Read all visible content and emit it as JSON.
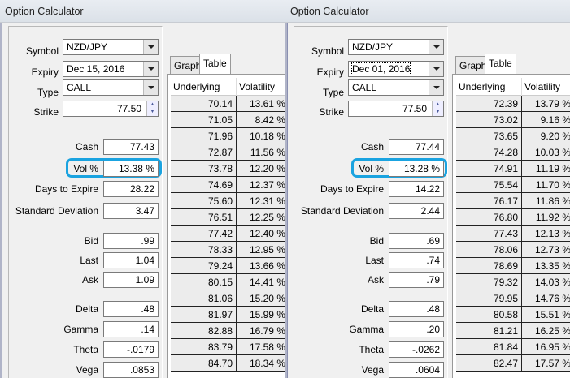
{
  "labels": {
    "symbol": "Symbol",
    "expiry": "Expiry",
    "type": "Type",
    "strike": "Strike",
    "cash": "Cash",
    "vol": "Vol %",
    "days": "Days to Expire",
    "sd": "Standard Deviation",
    "bid": "Bid",
    "last": "Last",
    "ask": "Ask",
    "delta": "Delta",
    "gamma": "Gamma",
    "theta": "Theta",
    "vega": "Vega",
    "tab_graph": "Graph",
    "tab_table": "Table",
    "col_underlying": "Underlying",
    "col_volatility": "Volatility"
  },
  "accent": "#1aa3e0",
  "panels": [
    {
      "title": "Option Calculator",
      "symbol": "NZD/JPY",
      "expiry": "Dec 15, 2016",
      "type": "CALL",
      "strike": "77.50",
      "cash": "77.43",
      "vol": "13.38 %",
      "days": "28.22",
      "sd": "3.47",
      "bid": ".99",
      "last": "1.04",
      "ask": "1.09",
      "delta": ".48",
      "gamma": ".14",
      "theta": "-.0179",
      "vega": ".0853",
      "rows": [
        [
          "70.14",
          "13.61 %"
        ],
        [
          "71.05",
          "8.42 %"
        ],
        [
          "71.96",
          "10.18 %"
        ],
        [
          "72.87",
          "11.56 %"
        ],
        [
          "73.78",
          "12.20 %"
        ],
        [
          "74.69",
          "12.37 %"
        ],
        [
          "75.60",
          "12.31 %"
        ],
        [
          "76.51",
          "12.25 %"
        ],
        [
          "77.42",
          "12.40 %"
        ],
        [
          "78.33",
          "12.95 %"
        ],
        [
          "79.24",
          "13.66 %"
        ],
        [
          "80.15",
          "14.41 %"
        ],
        [
          "81.06",
          "15.20 %"
        ],
        [
          "81.97",
          "15.99 %"
        ],
        [
          "82.88",
          "16.79 %"
        ],
        [
          "83.79",
          "17.58 %"
        ],
        [
          "84.70",
          "18.34 %"
        ]
      ]
    },
    {
      "title": "Option Calculator",
      "symbol": "NZD/JPY",
      "expiry": "Dec 01, 2016",
      "type": "CALL",
      "strike": "77.50",
      "cash": "77.44",
      "vol": "13.28 %",
      "days": "14.22",
      "sd": "2.44",
      "bid": ".69",
      "last": ".74",
      "ask": ".79",
      "delta": ".48",
      "gamma": ".20",
      "theta": "-.0262",
      "vega": ".0604",
      "rows": [
        [
          "72.39",
          "13.79 %"
        ],
        [
          "73.02",
          "9.16 %"
        ],
        [
          "73.65",
          "9.20 %"
        ],
        [
          "74.28",
          "10.03 %"
        ],
        [
          "74.91",
          "11.19 %"
        ],
        [
          "75.54",
          "11.70 %"
        ],
        [
          "76.17",
          "11.86 %"
        ],
        [
          "76.80",
          "11.92 %"
        ],
        [
          "77.43",
          "12.13 %"
        ],
        [
          "78.06",
          "12.73 %"
        ],
        [
          "78.69",
          "13.35 %"
        ],
        [
          "79.32",
          "14.03 %"
        ],
        [
          "79.95",
          "14.76 %"
        ],
        [
          "80.58",
          "15.51 %"
        ],
        [
          "81.21",
          "16.25 %"
        ],
        [
          "81.84",
          "16.95 %"
        ],
        [
          "82.47",
          "17.57 %"
        ]
      ]
    }
  ]
}
